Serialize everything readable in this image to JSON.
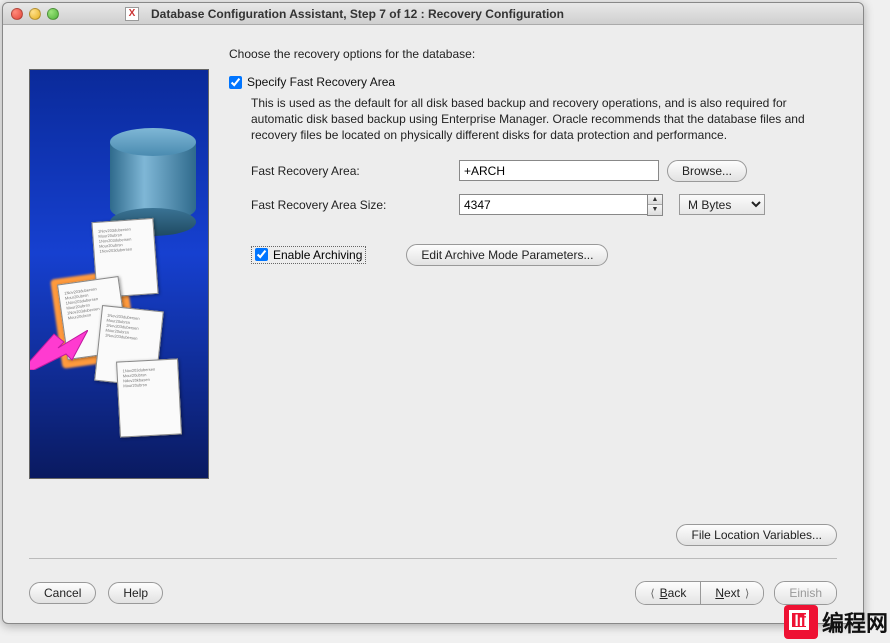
{
  "window": {
    "title": "Database Configuration Assistant, Step 7 of 12 : Recovery Configuration"
  },
  "main": {
    "instruction": "Choose the recovery options for the database:",
    "specify_fra_label": "Specify Fast Recovery Area",
    "fra_description": "This is used as the default for all disk based backup and recovery operations, and is also required for automatic disk based backup using Enterprise Manager. Oracle recommends that the database files and recovery files be located on physically different disks for data protection and performance.",
    "fra_label": "Fast Recovery Area:",
    "fra_value": "+ARCH",
    "browse_label": "Browse...",
    "fra_size_label": "Fast Recovery Area Size:",
    "fra_size_value": "4347",
    "fra_size_unit": "M Bytes",
    "enable_archiving_label": "Enable Archiving",
    "edit_archive_label": "Edit Archive Mode Parameters...",
    "file_loc_vars_label": "File Location Variables..."
  },
  "footer": {
    "cancel": "Cancel",
    "help": "Help",
    "back": "Back",
    "next": "Next"
  },
  "watermark": "编程网"
}
